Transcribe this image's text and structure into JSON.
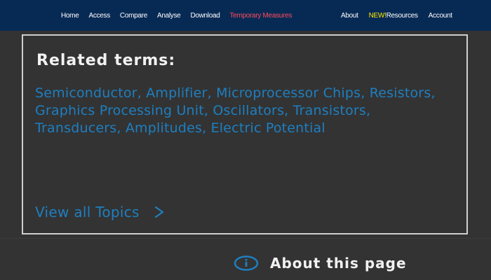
{
  "nav": {
    "left_items": [
      {
        "label": "Home"
      },
      {
        "label": "Access"
      },
      {
        "label": "Compare"
      },
      {
        "label": "Analyse"
      },
      {
        "label": "Download"
      },
      {
        "label": "Temporary Measures"
      }
    ],
    "right_items": [
      {
        "label": "About"
      },
      {
        "new_tag": "NEW!",
        "label": "Resources"
      },
      {
        "label": "Account"
      }
    ]
  },
  "panel": {
    "title": "Related terms:",
    "terms": [
      "Semiconductor",
      "Amplifier",
      "Microprocessor Chips",
      "Resistors",
      "Graphics Processing Unit",
      "Oscillators",
      "Transistors",
      "Transducers",
      "Amplitudes",
      "Electric Potential"
    ],
    "separator": ", ",
    "view_all_label": "View all Topics"
  },
  "footer": {
    "about_label": "About this page"
  },
  "colors": {
    "nav_bg": "#072a55",
    "page_bg": "#333333",
    "link": "#1e7fc0",
    "highlight_nav": "#ff4a5a",
    "new_tag": "#ffe600"
  },
  "icons": {
    "view_all": "chevron-right-icon",
    "about": "info-icon"
  }
}
